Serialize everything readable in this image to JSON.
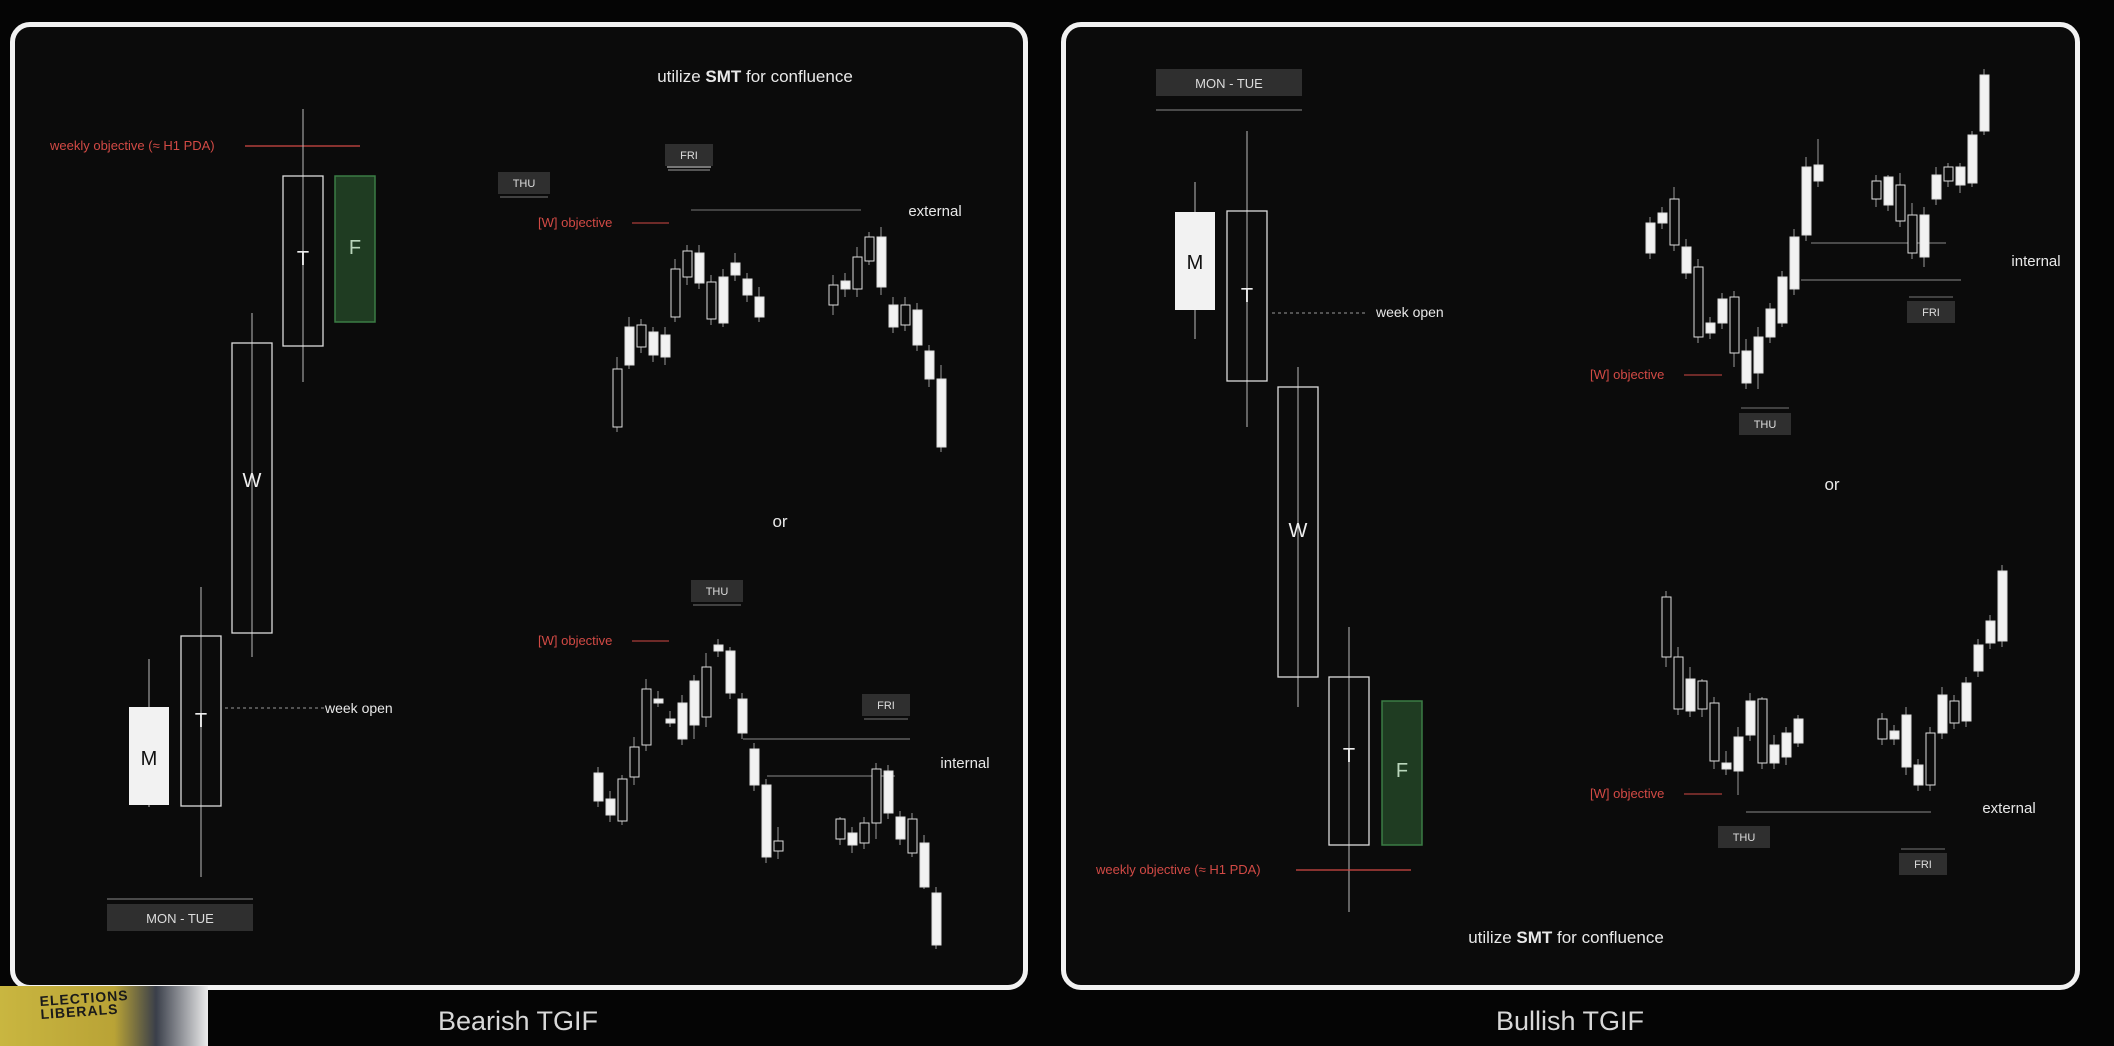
{
  "left_panel": {
    "caption": "Bearish TGIF",
    "smt_prefix": "utilize ",
    "smt_bold": "SMT",
    "smt_suffix": " for confluence",
    "weekly_objective": "weekly objective (≈ H1 PDA)",
    "week_open": "week open",
    "mon_tue": "MON - TUE",
    "candle_labels": {
      "m": "M",
      "t1": "T",
      "w": "W",
      "t2": "T",
      "f": "F"
    },
    "or": "or",
    "top_chart": {
      "thu": "THU",
      "fri": "FRI",
      "objective": "[W] objective",
      "note": "external"
    },
    "bottom_chart": {
      "thu": "THU",
      "fri": "FRI",
      "objective": "[W] objective",
      "note": "internal"
    }
  },
  "right_panel": {
    "caption": "Bullish TGIF",
    "smt_prefix": "utilize ",
    "smt_bold": "SMT",
    "smt_suffix": " for confluence",
    "weekly_objective": "weekly objective (≈ H1 PDA)",
    "week_open": "week open",
    "mon_tue": "MON - TUE",
    "candle_labels": {
      "m": "M",
      "t1": "T",
      "w": "W",
      "t2": "T",
      "f": "F"
    },
    "or": "or",
    "top_chart": {
      "thu": "THU",
      "fri": "FRI",
      "objective": "[W] objective",
      "note": "internal"
    },
    "bottom_chart": {
      "thu": "THU",
      "fri": "FRI",
      "objective": "[W] objective",
      "note": "external"
    }
  },
  "webcam": {
    "sign_text": "ELECTIONS LIBERALS"
  },
  "colors": {
    "objective_red": "#d24a45",
    "friday_green": "#3b7d44",
    "candle_bull": "#f2f2f2",
    "candle_bear_outline": "#dcdcdc"
  }
}
